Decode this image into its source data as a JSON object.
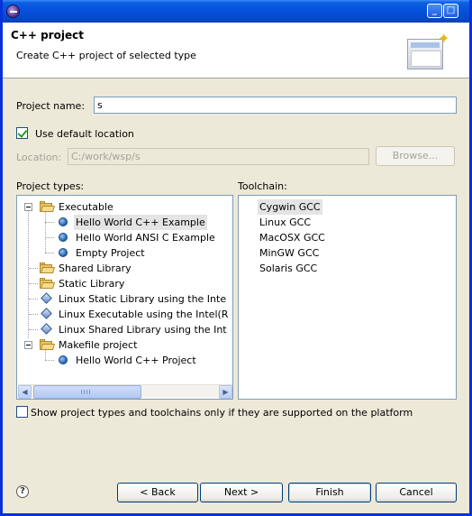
{
  "window": {
    "title": ""
  },
  "header": {
    "title": "C++ project",
    "description": "Create C++ project of selected type"
  },
  "form": {
    "project_name_label": "Project name:",
    "project_name_value": "s",
    "use_default_location_label": "Use default location",
    "use_default_location_checked": true,
    "location_label": "Location:",
    "location_value": "C:/work/wsp/s",
    "browse_label": "Browse..."
  },
  "project_types": {
    "label": "Project types:",
    "items": [
      {
        "label": "Executable",
        "icon": "folder-open-icon",
        "level": 0,
        "expanded": true
      },
      {
        "label": "Hello World C++ Example",
        "icon": "template-icon",
        "level": 1,
        "selected": true
      },
      {
        "label": "Hello World ANSI C Example",
        "icon": "template-icon",
        "level": 1
      },
      {
        "label": "Empty Project",
        "icon": "template-icon",
        "level": 1
      },
      {
        "label": "Shared Library",
        "icon": "folder-icon",
        "level": 0
      },
      {
        "label": "Static Library",
        "icon": "folder-icon",
        "level": 0
      },
      {
        "label": "Linux Static Library using the Inte",
        "icon": "diamond-icon",
        "level": 0
      },
      {
        "label": "Linux Executable using the Intel(R",
        "icon": "diamond-icon",
        "level": 0
      },
      {
        "label": "Linux Shared Library using the Int",
        "icon": "diamond-icon",
        "level": 0
      },
      {
        "label": "Makefile project",
        "icon": "folder-open-icon",
        "level": 0,
        "expanded": true
      },
      {
        "label": "Hello World C++ Project",
        "icon": "template-icon",
        "level": 1
      }
    ]
  },
  "toolchain": {
    "label": "Toolchain:",
    "items": [
      {
        "label": "Cygwin GCC",
        "selected": true
      },
      {
        "label": "Linux GCC"
      },
      {
        "label": "MacOSX GCC"
      },
      {
        "label": "MinGW GCC"
      },
      {
        "label": "Solaris GCC"
      }
    ]
  },
  "filter_checkbox": {
    "label": "Show project types and toolchains only if they are supported on the platform",
    "checked": false
  },
  "buttons": {
    "back": "< Back",
    "next": "Next >",
    "finish": "Finish",
    "cancel": "Cancel"
  },
  "colors": {
    "title_bar": "#0650db",
    "selection_bg": "#e4e4e4",
    "window_bg": "#ece9d8"
  }
}
